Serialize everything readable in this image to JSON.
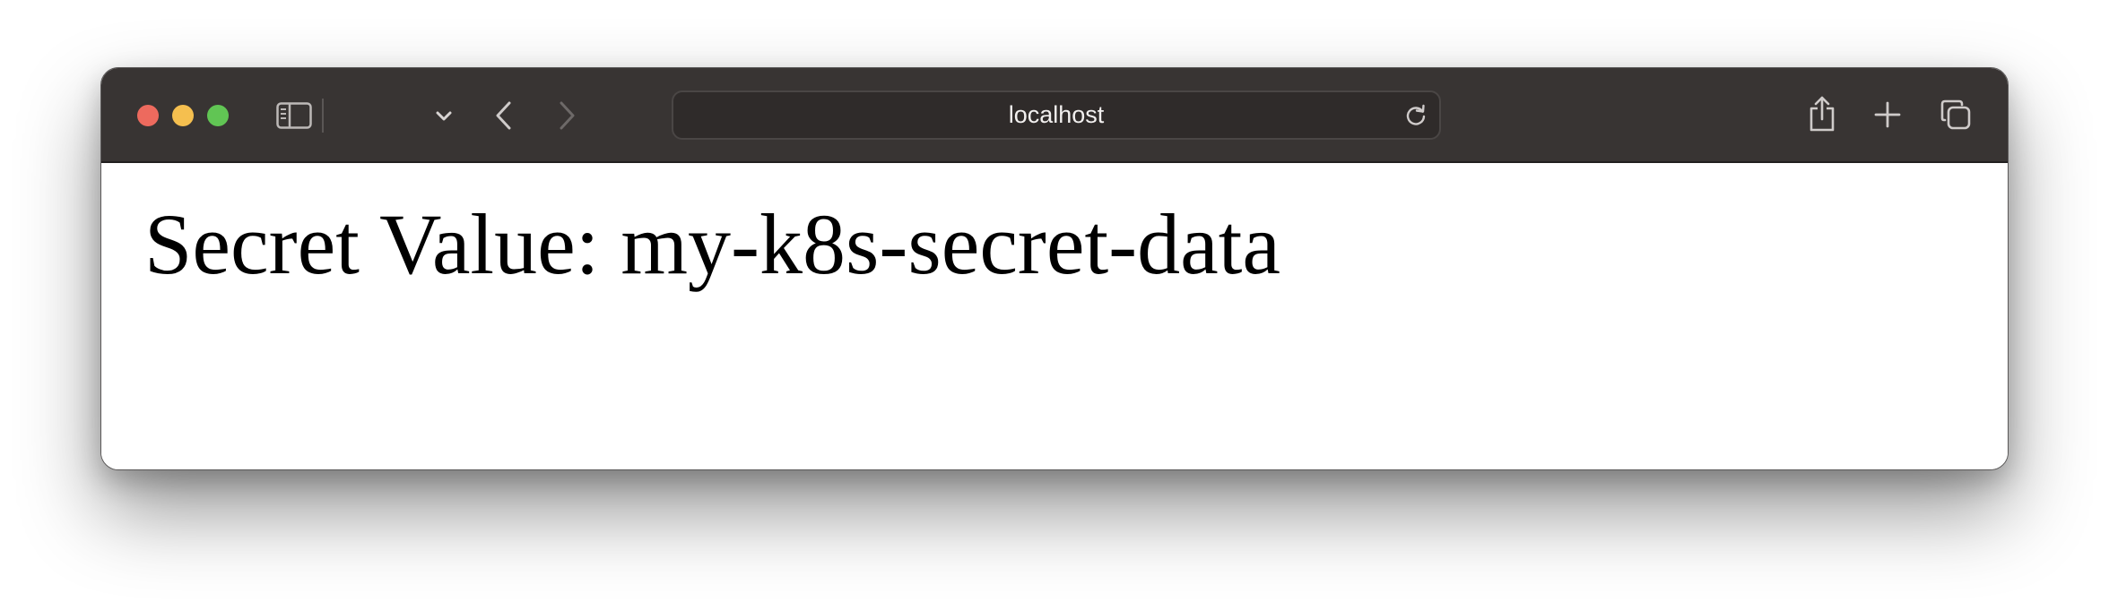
{
  "browser": {
    "address_bar": {
      "url": "localhost"
    },
    "traffic_lights": {
      "close_color": "#ed6a5e",
      "minimize_color": "#f5bf4f",
      "zoom_color": "#61c554"
    },
    "toolbar_icons": [
      "sidebar-icon",
      "chevron-down-icon",
      "back-icon",
      "forward-icon",
      "ghostery-extension-icon",
      "reload-icon",
      "share-icon",
      "new-tab-icon",
      "tab-overview-icon"
    ],
    "accent_colors": {
      "toolbar_bg": "#383433",
      "extension_icon": "#4aa3e0"
    }
  },
  "page": {
    "heading": "Secret Value: my-k8s-secret-data"
  }
}
